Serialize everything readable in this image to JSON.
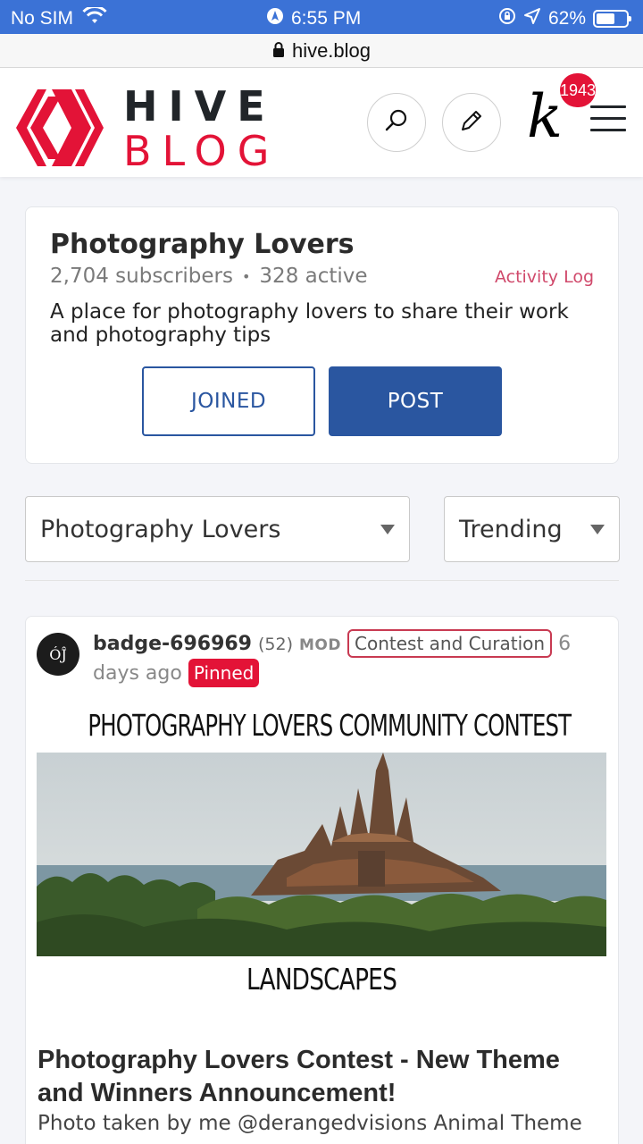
{
  "status_bar": {
    "carrier": "No SIM",
    "time": "6:55 PM",
    "battery_percent": "62%",
    "battery_level": 0.62
  },
  "browser": {
    "url": "hive.blog"
  },
  "header": {
    "logo_line1": "HIVE",
    "logo_line2": "BLOG",
    "avatar_letter": "k",
    "notification_count": "1943",
    "brand_color": "#e31337"
  },
  "community": {
    "title": "Photography Lovers",
    "subscribers": "2,704 subscribers",
    "separator": "•",
    "active": "328 active",
    "activity_log_label": "Activity Log",
    "description": "A place for photography lovers to share their work and photography tips",
    "joined_label": "JOINED",
    "post_label": "POST",
    "accent_color": "#2a56a0"
  },
  "filters": {
    "community_selected": "Photography Lovers",
    "sort_selected": "Trending"
  },
  "post": {
    "avatar_text": "ÓĴ",
    "author": "badge-696969",
    "reputation": "(52)",
    "role": "MOD",
    "community_tag": "Contest and Curation",
    "age": "6 days ago",
    "pinned_label": "Pinned",
    "image_header": "PHOTOGRAPHY LOVERS COMMUNITY CONTEST",
    "image_footer": "LANDSCAPES",
    "title": "Photography Lovers Contest - New Theme and Winners Announcement!",
    "body_preview": "Photo taken by me @derangedvisions Animal Theme"
  }
}
